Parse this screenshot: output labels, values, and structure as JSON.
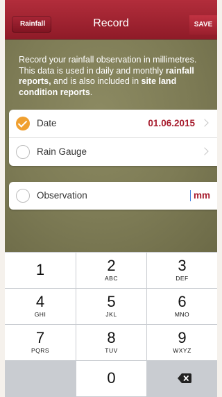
{
  "header": {
    "back_label": "Rainfall",
    "title": "Record",
    "save_label": "SAVE"
  },
  "intro": {
    "part1": "Record your rainfall observation in millimetres. This data is used in daily and monthly ",
    "bold1": "rainfall reports,",
    "part2": " and is also included in ",
    "bold2": "site land condition reports",
    "part3": "."
  },
  "form": {
    "date_label": "Date",
    "date_value": "01.06.2015",
    "date_checked": true,
    "gauge_label": "Rain Gauge",
    "gauge_checked": false,
    "observation_label": "Observation",
    "observation_checked": false,
    "observation_value": "",
    "observation_unit": "mm"
  },
  "keypad": {
    "keys": [
      {
        "num": "1",
        "letters": ""
      },
      {
        "num": "2",
        "letters": "ABC"
      },
      {
        "num": "3",
        "letters": "DEF"
      },
      {
        "num": "4",
        "letters": "GHI"
      },
      {
        "num": "5",
        "letters": "JKL"
      },
      {
        "num": "6",
        "letters": "MNO"
      },
      {
        "num": "7",
        "letters": "PQRS"
      },
      {
        "num": "8",
        "letters": "TUV"
      },
      {
        "num": "9",
        "letters": "WXYZ"
      },
      {
        "num": "0",
        "letters": ""
      }
    ],
    "delete_icon": "backspace-icon"
  },
  "colors": {
    "header": "#9e2030",
    "accent": "#a71d2e",
    "check": "#f0a030",
    "background": "#7d7b55"
  }
}
